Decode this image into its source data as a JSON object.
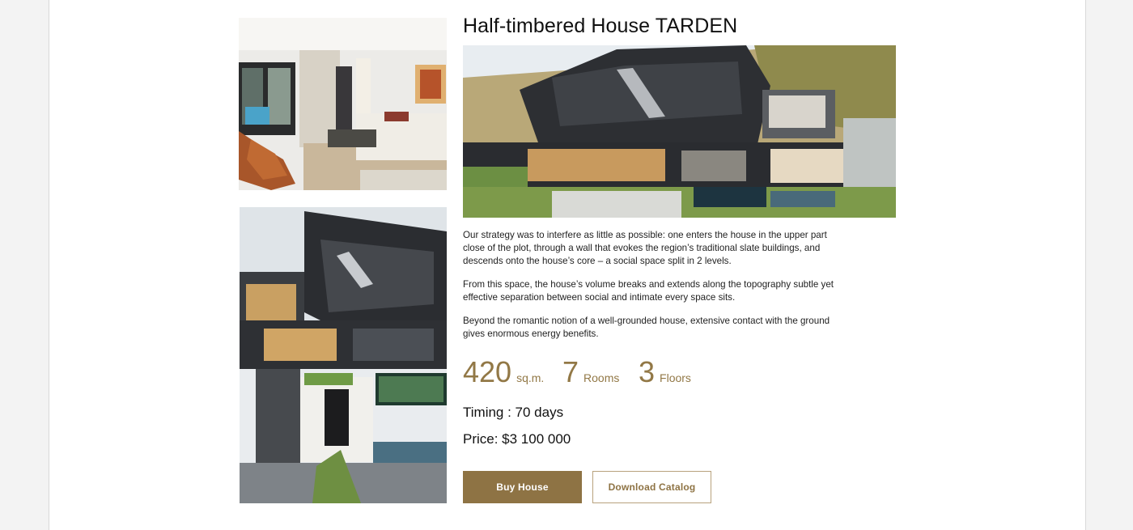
{
  "house": {
    "title": "Half-timbered House TARDEN",
    "description": [
      "Our strategy was to interfere as little as possible: one enters the house in the upper part close of the plot, through a wall that evokes the region’s traditional slate buildings, and descends onto the house’s core – a social space split in 2 levels.",
      "From this space, the house’s volume breaks and extends along the topography subtle yet effective separation between social and intimate every space sits.",
      "Beyond the romantic notion of a well-grounded house, extensive contact with the ground gives enormous energy benefits."
    ],
    "stats": {
      "area": {
        "value": "420",
        "unit": "sq.m."
      },
      "rooms": {
        "value": "7",
        "unit": "Rooms"
      },
      "floors": {
        "value": "3",
        "unit": "Floors"
      }
    },
    "timing": "Timing : 70 days",
    "price": "Price: $3 100 000"
  },
  "actions": {
    "buy_label": "Buy House",
    "catalog_label": "Download Catalog"
  },
  "colors": {
    "accent": "#8e7344",
    "page_background": "#f3f3f3",
    "card_background": "#ffffff"
  }
}
